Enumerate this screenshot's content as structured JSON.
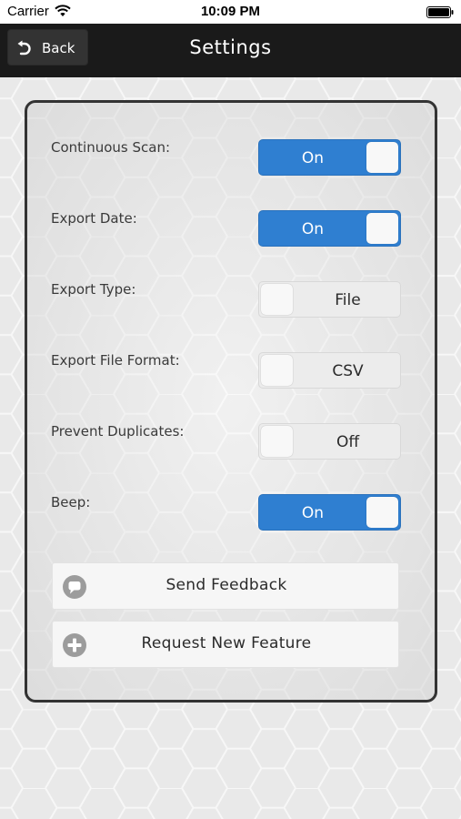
{
  "status_bar": {
    "carrier": "Carrier",
    "time": "10:09 PM",
    "wifi_icon": "wifi-icon",
    "battery_icon": "battery-icon"
  },
  "nav": {
    "back_label": "Back",
    "back_icon": "undo-arrow-icon",
    "title": "Settings"
  },
  "settings": [
    {
      "label": "Continuous Scan:",
      "state": "on",
      "value_text": "On"
    },
    {
      "label": "Export Date:",
      "state": "on",
      "value_text": "On"
    },
    {
      "label": "Export Type:",
      "state": "off",
      "value_text": "File"
    },
    {
      "label": "Export File Format:",
      "state": "off",
      "value_text": "CSV"
    },
    {
      "label": "Prevent Duplicates:",
      "state": "off",
      "value_text": "Off"
    },
    {
      "label": "Beep:",
      "state": "on",
      "value_text": "On"
    }
  ],
  "actions": {
    "feedback": {
      "label": "Send Feedback",
      "icon": "speech-bubble-icon"
    },
    "feature": {
      "label": "Request New Feature",
      "icon": "plus-circle-icon"
    }
  },
  "colors": {
    "toggle_on": "#2f7fd1",
    "nav_bar": "#1a1a1a",
    "panel_border": "#333333"
  }
}
